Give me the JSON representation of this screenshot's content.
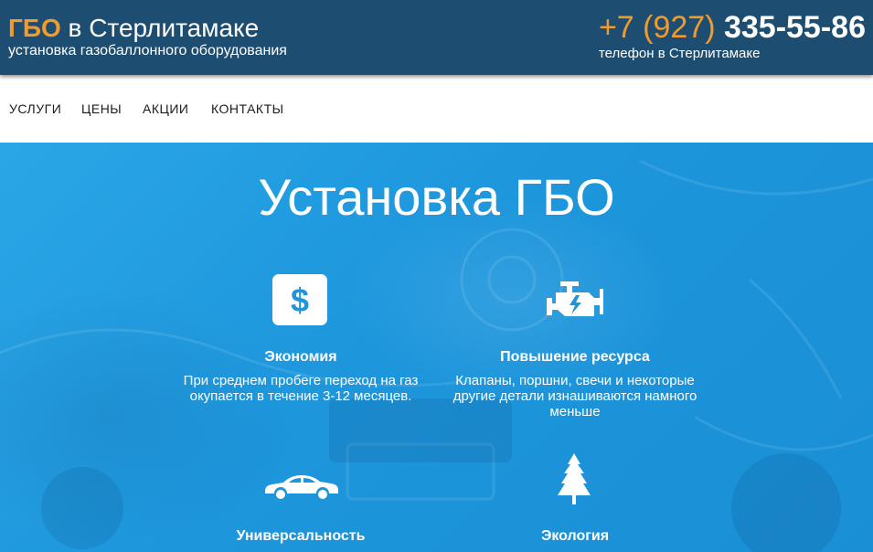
{
  "header": {
    "brand_accent": "ГБО",
    "brand_rest": " в Стерлитамаке",
    "tagline": "установка газобаллонного оборудования",
    "phone_code": "+7 (927)",
    "phone_main": " 335-55-86",
    "phone_caption": "телефон в Стерлитамаке"
  },
  "nav": {
    "items": [
      "УСЛУГИ",
      "ЦЕНЫ",
      "АКЦИИ",
      "КОНТАКТЫ"
    ]
  },
  "hero": {
    "title": "Установка ГБО",
    "features": [
      {
        "icon": "dollar-icon",
        "title": "Экономия",
        "text": "При среднем пробеге переход на газ окупается в течение 3-12 месяцев."
      },
      {
        "icon": "engine-icon",
        "title": "Повышение ресурса",
        "text": "Клапаны, поршни, свечи и некоторые другие детали изнашиваются намного меньше"
      },
      {
        "icon": "car-icon",
        "title": "Универсальность",
        "text": ""
      },
      {
        "icon": "tree-icon",
        "title": "Экология",
        "text": ""
      }
    ]
  },
  "colors": {
    "header_bg": "#1d4e72",
    "accent": "#f39a2a",
    "hero_bg": "#1d96dc"
  }
}
